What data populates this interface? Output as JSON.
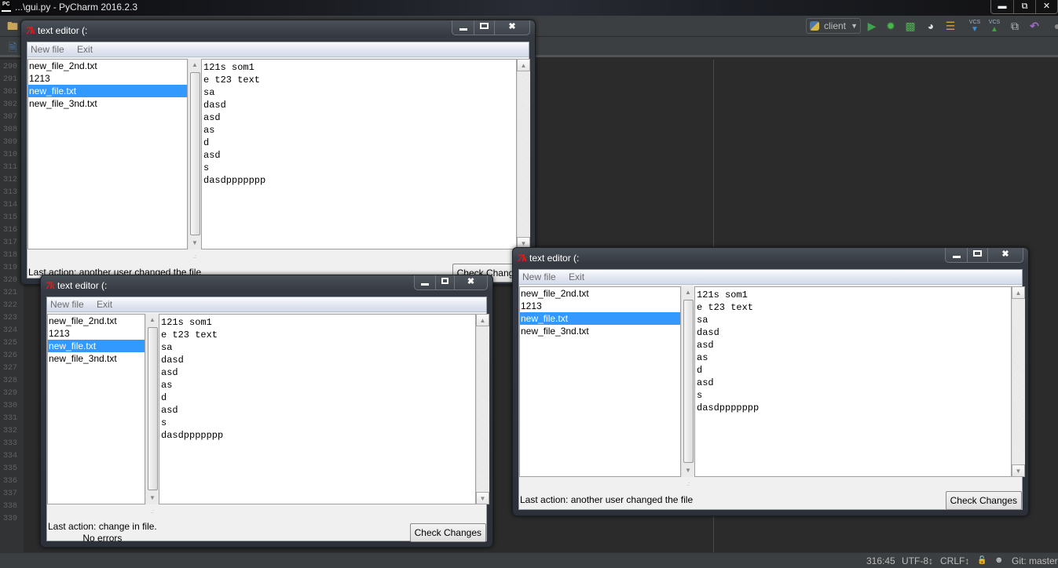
{
  "ide": {
    "logo": "PC",
    "window_title": "...\\gui.py - PyCharm 2016.2.3",
    "window_buttons": [
      "minimize",
      "restore",
      "close"
    ],
    "toolbar": {
      "run_config": "client",
      "icons": [
        "run-icon",
        "debug-icon",
        "coverage-icon",
        "profile-icon",
        "concurrency-icon",
        "vcs-update-icon",
        "vcs-commit-icon",
        "vcs-history-icon",
        "revert-icon"
      ],
      "vcs_label": "VCS"
    },
    "gutter_lines": [
      "290",
      "291",
      "301",
      "302",
      "307",
      "308",
      "309",
      "310",
      "311",
      "312",
      "313",
      "314",
      "315",
      "316",
      "317",
      "318",
      "319",
      "320",
      "321",
      "322",
      "323",
      "324",
      "325",
      "326",
      "327",
      "328",
      "329",
      "330",
      "331",
      "332",
      "333",
      "334",
      "335",
      "336",
      "337",
      "338",
      "339"
    ],
    "statusbar": {
      "position": "316:45",
      "encoding": "UTF-8↕",
      "line_sep": "CRLF↕",
      "vcs_branch": "Git: master"
    }
  },
  "tk_windows": [
    {
      "title": "text editor (:",
      "menu": [
        "New file",
        "Exit"
      ],
      "files": [
        "new_file_2nd.txt",
        "1213",
        "new_file.txt",
        "new_file_3nd.txt"
      ],
      "selected_index": 2,
      "text_lines": [
        "121s som1",
        "e t23 text",
        "sa",
        "dasd",
        "asd",
        "as",
        "d",
        "asd",
        "s",
        "dasdppppppp"
      ],
      "status_lines": [
        "Last action: another user changed the file"
      ],
      "button": "Check Changes"
    },
    {
      "title": "text editor (:",
      "menu": [
        "New file",
        "Exit"
      ],
      "files": [
        "new_file_2nd.txt",
        "1213",
        "new_file.txt",
        "new_file_3nd.txt"
      ],
      "selected_index": 2,
      "text_lines": [
        "121s som1",
        "e t23 text",
        "sa",
        "dasd",
        "asd",
        "as",
        "d",
        "asd",
        "s",
        "dasdppppppp"
      ],
      "status_lines": [
        "Last action: change in file.",
        "No errors"
      ],
      "button": "Check Changes"
    },
    {
      "title": "text editor (:",
      "menu": [
        "New file",
        "Exit"
      ],
      "files": [
        "new_file_2nd.txt",
        "1213",
        "new_file.txt",
        "new_file_3nd.txt"
      ],
      "selected_index": 2,
      "text_lines": [
        "121s som1",
        "e t23 text",
        "sa",
        "dasd",
        "asd",
        "as",
        "d",
        "asd",
        "s",
        "dasdppppppp"
      ],
      "status_lines": [
        "Last action: another user changed the file"
      ],
      "button": "Check Changes"
    }
  ]
}
